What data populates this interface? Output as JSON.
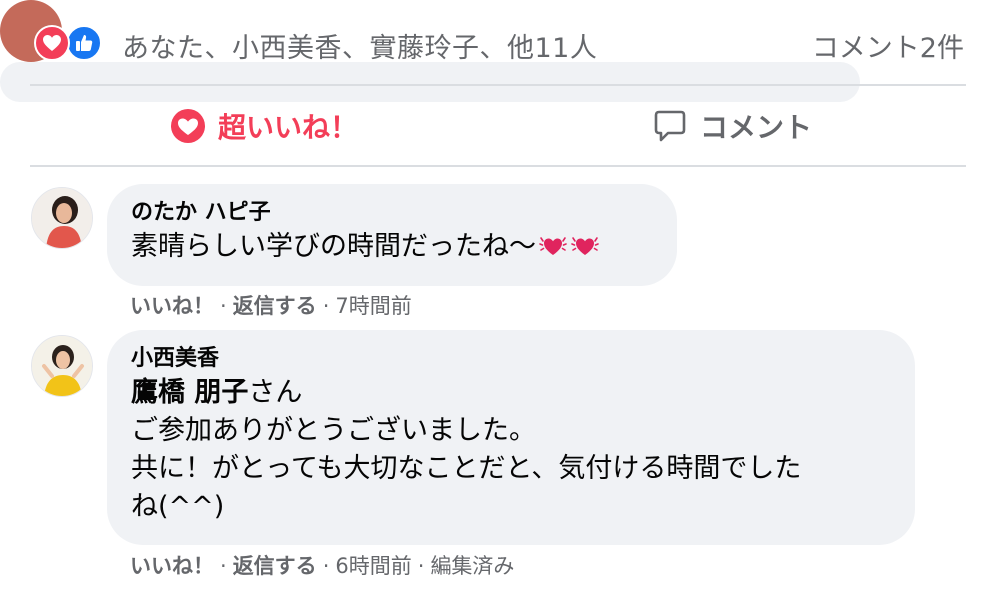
{
  "reactions": {
    "icons": [
      "love-reaction-icon",
      "like-reaction-icon"
    ],
    "reactors_text": "あなた、小西美香、實藤玲子、他11人",
    "comment_count": "コメント2件"
  },
  "actions": {
    "love_label": "超いいね！",
    "comment_label": "コメント"
  },
  "comments": [
    {
      "author": "のたか ハピ子",
      "text": "素晴らしい学びの時間だったね〜",
      "emoji": [
        "vibrating-heart-icon",
        "vibrating-heart-icon"
      ],
      "meta": {
        "like": "いいね！",
        "reply": "返信する",
        "time": "7時間前"
      }
    },
    {
      "author": "小西美香",
      "mention": "鷹橋 朋子",
      "mention_suffix": "さん",
      "line1": "ご参加ありがとうございました。",
      "line2": "共に！がとっても大切なことだと、気付ける時間でした",
      "line3": "ね(^^)",
      "meta": {
        "like": "いいね！",
        "reply": "返信する",
        "time": "6時間前",
        "edited": "編集済み"
      }
    }
  ],
  "colors": {
    "love": "#f33e58",
    "like": "#1877f2",
    "secondary_text": "#65676b",
    "bubble": "#f0f2f5"
  }
}
